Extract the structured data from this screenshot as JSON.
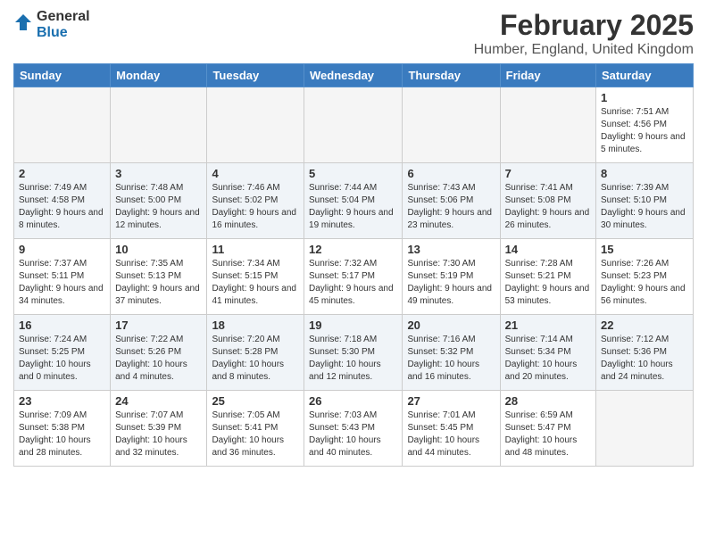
{
  "logo": {
    "general": "General",
    "blue": "Blue"
  },
  "title": {
    "month": "February 2025",
    "location": "Humber, England, United Kingdom"
  },
  "headers": [
    "Sunday",
    "Monday",
    "Tuesday",
    "Wednesday",
    "Thursday",
    "Friday",
    "Saturday"
  ],
  "weeks": [
    [
      {
        "day": "",
        "info": ""
      },
      {
        "day": "",
        "info": ""
      },
      {
        "day": "",
        "info": ""
      },
      {
        "day": "",
        "info": ""
      },
      {
        "day": "",
        "info": ""
      },
      {
        "day": "",
        "info": ""
      },
      {
        "day": "1",
        "info": "Sunrise: 7:51 AM\nSunset: 4:56 PM\nDaylight: 9 hours and 5 minutes."
      }
    ],
    [
      {
        "day": "2",
        "info": "Sunrise: 7:49 AM\nSunset: 4:58 PM\nDaylight: 9 hours and 8 minutes."
      },
      {
        "day": "3",
        "info": "Sunrise: 7:48 AM\nSunset: 5:00 PM\nDaylight: 9 hours and 12 minutes."
      },
      {
        "day": "4",
        "info": "Sunrise: 7:46 AM\nSunset: 5:02 PM\nDaylight: 9 hours and 16 minutes."
      },
      {
        "day": "5",
        "info": "Sunrise: 7:44 AM\nSunset: 5:04 PM\nDaylight: 9 hours and 19 minutes."
      },
      {
        "day": "6",
        "info": "Sunrise: 7:43 AM\nSunset: 5:06 PM\nDaylight: 9 hours and 23 minutes."
      },
      {
        "day": "7",
        "info": "Sunrise: 7:41 AM\nSunset: 5:08 PM\nDaylight: 9 hours and 26 minutes."
      },
      {
        "day": "8",
        "info": "Sunrise: 7:39 AM\nSunset: 5:10 PM\nDaylight: 9 hours and 30 minutes."
      }
    ],
    [
      {
        "day": "9",
        "info": "Sunrise: 7:37 AM\nSunset: 5:11 PM\nDaylight: 9 hours and 34 minutes."
      },
      {
        "day": "10",
        "info": "Sunrise: 7:35 AM\nSunset: 5:13 PM\nDaylight: 9 hours and 37 minutes."
      },
      {
        "day": "11",
        "info": "Sunrise: 7:34 AM\nSunset: 5:15 PM\nDaylight: 9 hours and 41 minutes."
      },
      {
        "day": "12",
        "info": "Sunrise: 7:32 AM\nSunset: 5:17 PM\nDaylight: 9 hours and 45 minutes."
      },
      {
        "day": "13",
        "info": "Sunrise: 7:30 AM\nSunset: 5:19 PM\nDaylight: 9 hours and 49 minutes."
      },
      {
        "day": "14",
        "info": "Sunrise: 7:28 AM\nSunset: 5:21 PM\nDaylight: 9 hours and 53 minutes."
      },
      {
        "day": "15",
        "info": "Sunrise: 7:26 AM\nSunset: 5:23 PM\nDaylight: 9 hours and 56 minutes."
      }
    ],
    [
      {
        "day": "16",
        "info": "Sunrise: 7:24 AM\nSunset: 5:25 PM\nDaylight: 10 hours and 0 minutes."
      },
      {
        "day": "17",
        "info": "Sunrise: 7:22 AM\nSunset: 5:26 PM\nDaylight: 10 hours and 4 minutes."
      },
      {
        "day": "18",
        "info": "Sunrise: 7:20 AM\nSunset: 5:28 PM\nDaylight: 10 hours and 8 minutes."
      },
      {
        "day": "19",
        "info": "Sunrise: 7:18 AM\nSunset: 5:30 PM\nDaylight: 10 hours and 12 minutes."
      },
      {
        "day": "20",
        "info": "Sunrise: 7:16 AM\nSunset: 5:32 PM\nDaylight: 10 hours and 16 minutes."
      },
      {
        "day": "21",
        "info": "Sunrise: 7:14 AM\nSunset: 5:34 PM\nDaylight: 10 hours and 20 minutes."
      },
      {
        "day": "22",
        "info": "Sunrise: 7:12 AM\nSunset: 5:36 PM\nDaylight: 10 hours and 24 minutes."
      }
    ],
    [
      {
        "day": "23",
        "info": "Sunrise: 7:09 AM\nSunset: 5:38 PM\nDaylight: 10 hours and 28 minutes."
      },
      {
        "day": "24",
        "info": "Sunrise: 7:07 AM\nSunset: 5:39 PM\nDaylight: 10 hours and 32 minutes."
      },
      {
        "day": "25",
        "info": "Sunrise: 7:05 AM\nSunset: 5:41 PM\nDaylight: 10 hours and 36 minutes."
      },
      {
        "day": "26",
        "info": "Sunrise: 7:03 AM\nSunset: 5:43 PM\nDaylight: 10 hours and 40 minutes."
      },
      {
        "day": "27",
        "info": "Sunrise: 7:01 AM\nSunset: 5:45 PM\nDaylight: 10 hours and 44 minutes."
      },
      {
        "day": "28",
        "info": "Sunrise: 6:59 AM\nSunset: 5:47 PM\nDaylight: 10 hours and 48 minutes."
      },
      {
        "day": "",
        "info": ""
      }
    ]
  ]
}
